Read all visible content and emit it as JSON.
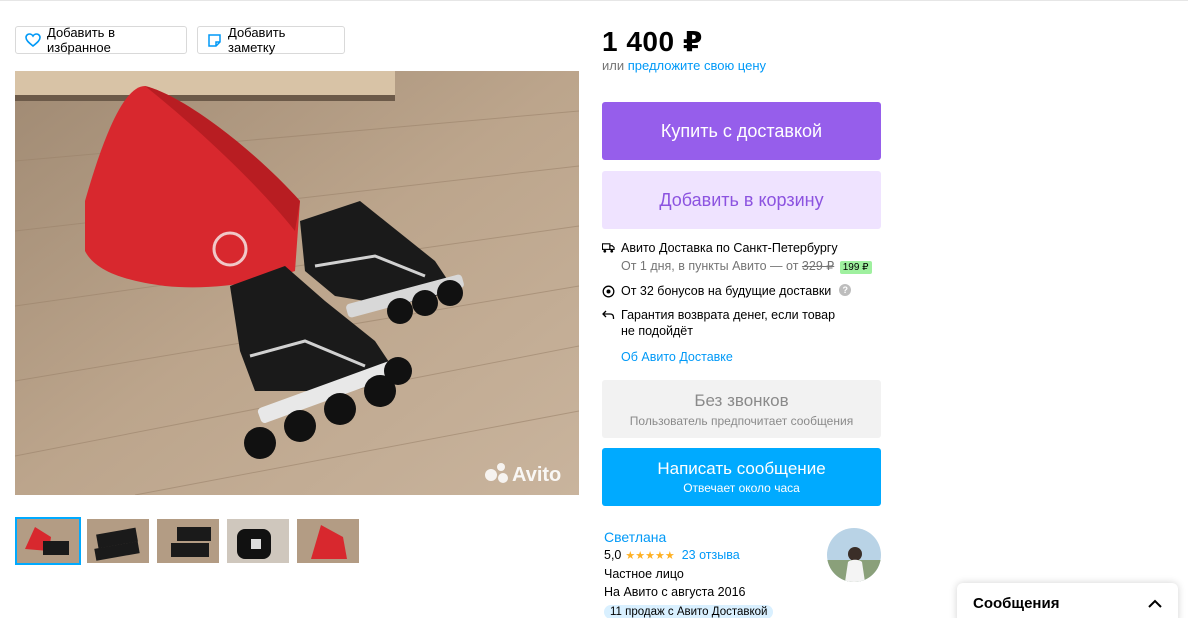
{
  "actions": {
    "favorite_label": "Добавить в избранное",
    "note_label": "Добавить заметку"
  },
  "gallery": {
    "watermark": "Avito",
    "thumbnail_count": 5
  },
  "price": {
    "value": "1 400 ₽",
    "or_text": "или",
    "offer_link": "предложите свою цену"
  },
  "buttons": {
    "buy_label": "Купить с доставкой",
    "cart_label": "Добавить в корзину",
    "no_calls_title": "Без звонков",
    "no_calls_sub": "Пользователь предпочитает сообщения",
    "message_title": "Написать сообщение",
    "message_sub": "Отвечает около часа"
  },
  "delivery": {
    "title": "Авито Доставка по Санкт-Петербургу",
    "sub_prefix": "От 1 дня, в пункты Авито — от",
    "old_price": "329 ₽",
    "new_price": "199 ₽",
    "bonus": "От 32 бонусов на будущие доставки",
    "guarantee_line1": "Гарантия возврата денег, если товар",
    "guarantee_line2": "не подойдёт",
    "about_link": "Об Авито Доставке"
  },
  "seller": {
    "name": "Светлана",
    "rating": "5,0",
    "stars": "★★★★★",
    "reviews": "23 отзыва",
    "type": "Частное лицо",
    "since": "На Авито с августа 2016",
    "sales_badge": "11 продаж с Авито Доставкой"
  },
  "messages_panel": {
    "title": "Сообщения"
  },
  "colors": {
    "purple": "#965eeb",
    "light_purple": "#efe3ff",
    "blue": "#00aaff",
    "link": "#0099f7",
    "star": "#ffb021"
  }
}
